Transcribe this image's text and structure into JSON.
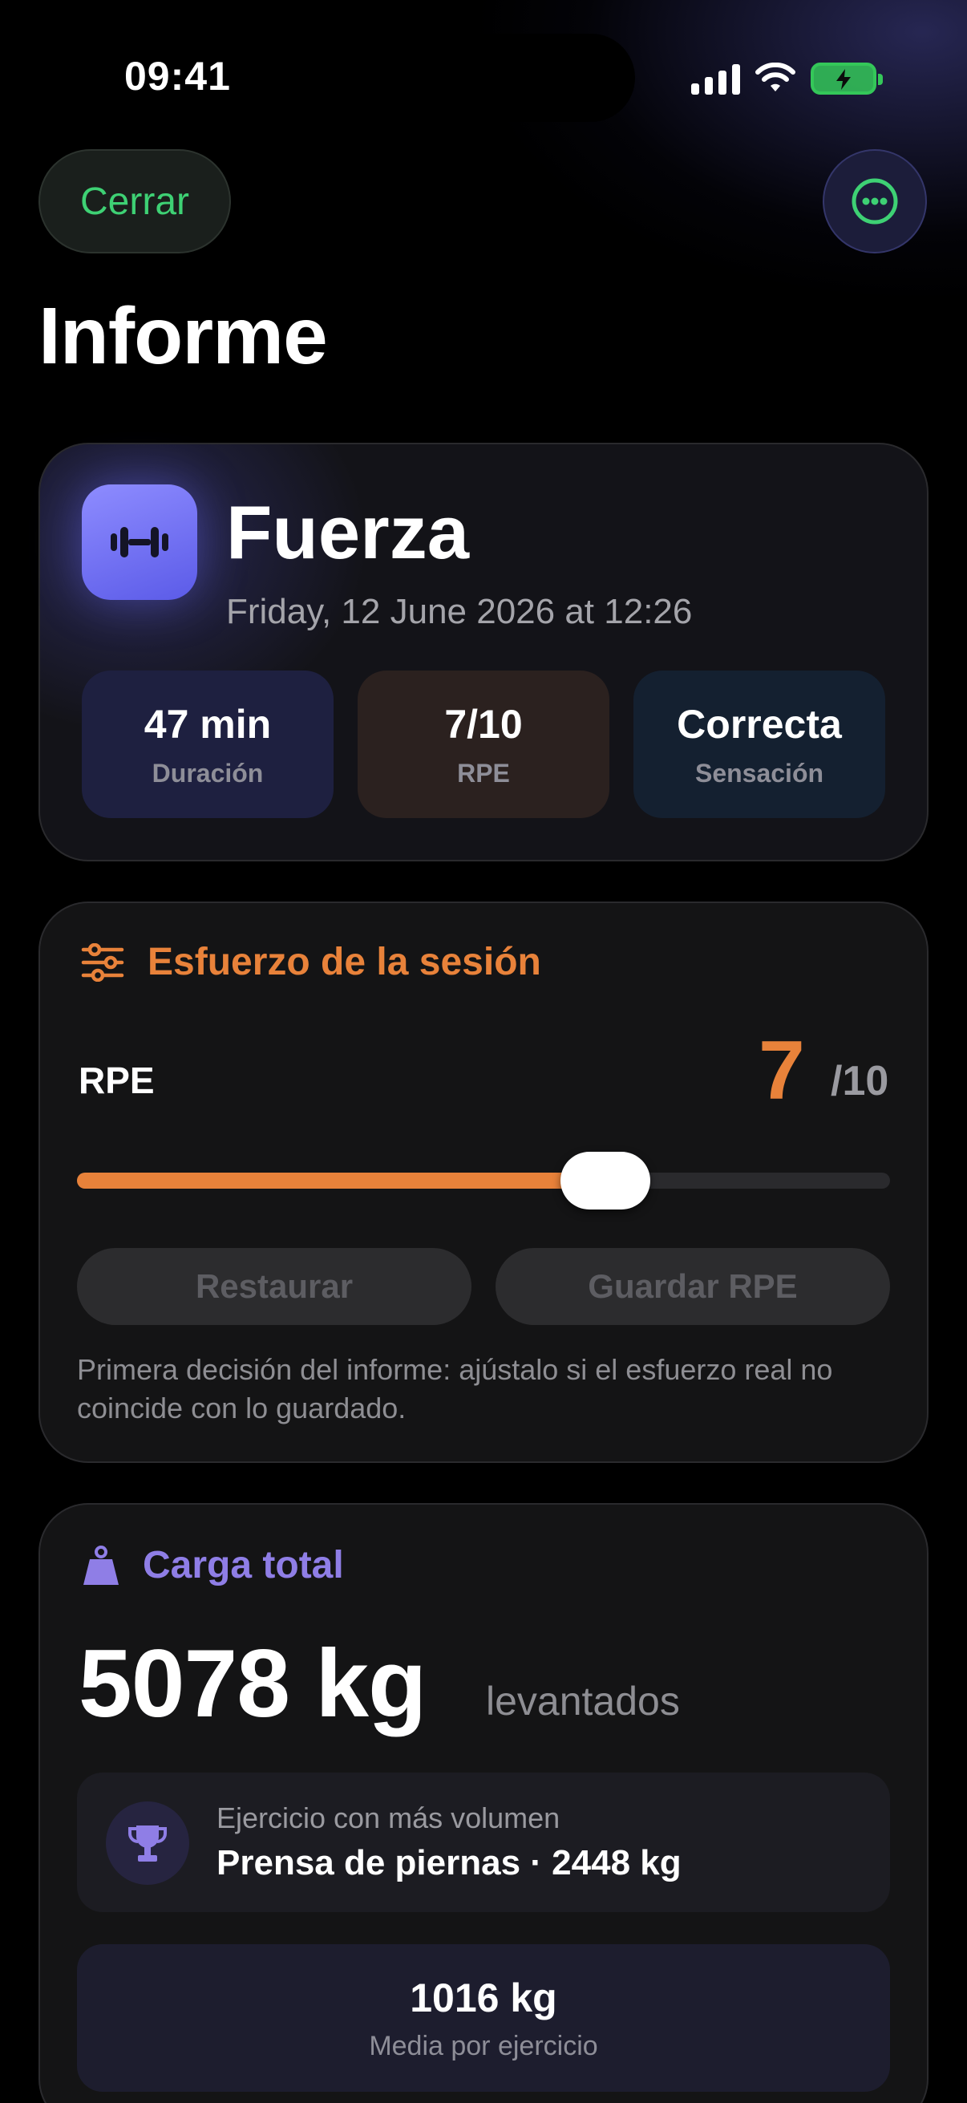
{
  "status_bar": {
    "time": "09:41"
  },
  "top_bar": {
    "close_label": "Cerrar"
  },
  "page": {
    "title": "Informe"
  },
  "summary": {
    "title": "Fuerza",
    "date": "Friday, 12 June 2026 at 12:26",
    "stats": [
      {
        "value": "47 min",
        "label": "Duración"
      },
      {
        "value": "7/10",
        "label": "RPE"
      },
      {
        "value": "Correcta",
        "label": "Sensación"
      }
    ]
  },
  "effort": {
    "heading": "Esfuerzo de la sesión",
    "rpe_label": "RPE",
    "rpe_value": "7",
    "rpe_max": "/10",
    "slider_fraction": 0.65,
    "reset_label": "Restaurar",
    "save_label": "Guardar RPE",
    "note": "Primera decisión del informe: ajústalo si el esfuerzo real no coincide con lo guardado.",
    "accent": "#e8823a"
  },
  "load": {
    "heading": "Carga total",
    "total": "5078 kg",
    "suffix": "levantados",
    "top_exercise_label": "Ejercicio con más volumen",
    "top_exercise_value": "Prensa de piernas · 2448 kg",
    "average_value": "1016 kg",
    "average_label": "Media por ejercicio",
    "accent": "#8f7ee6"
  },
  "icons": [
    "signal-icon",
    "wifi-icon",
    "battery-charging-icon",
    "more-icon",
    "dumbbell-icon",
    "sliders-icon",
    "weight-icon",
    "trophy-icon"
  ]
}
